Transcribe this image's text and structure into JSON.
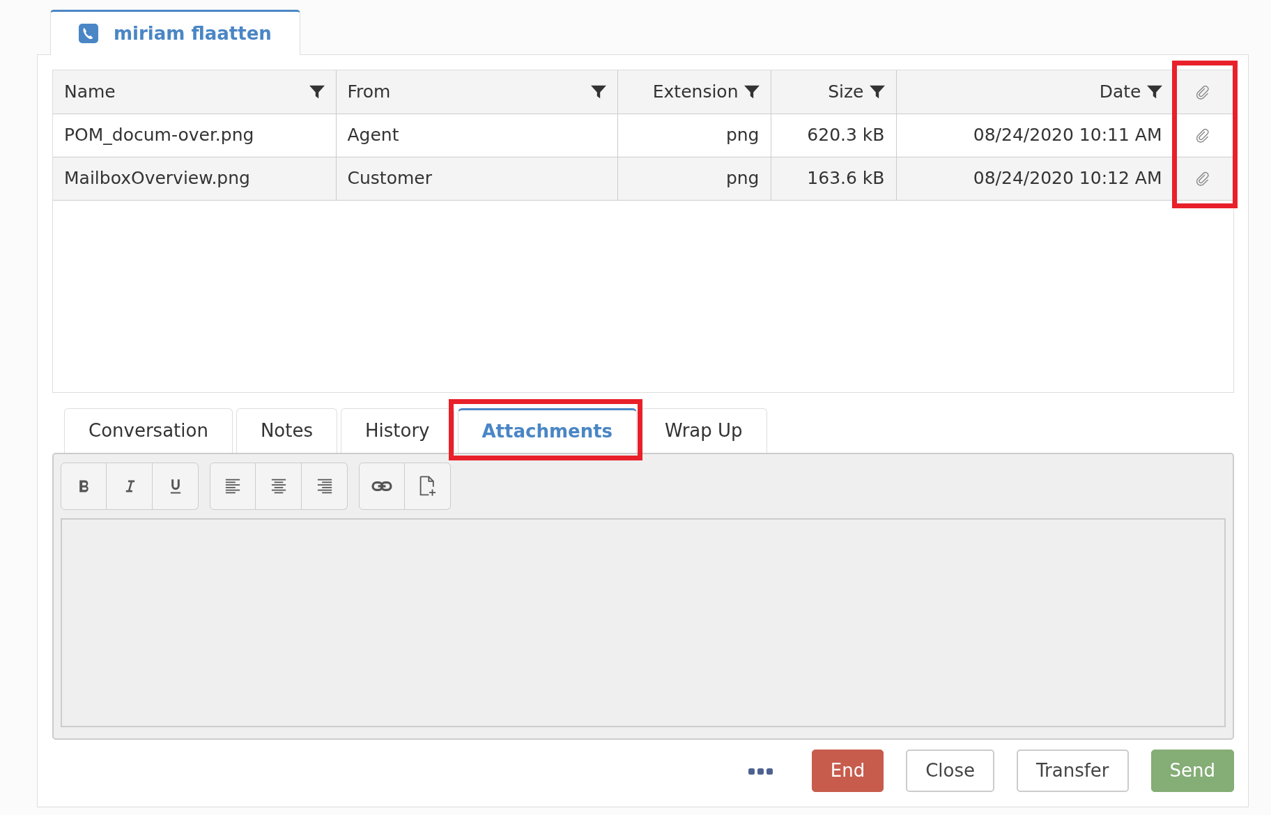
{
  "contact_tab": {
    "label": "miriam flaatten",
    "selected": true
  },
  "table": {
    "columns": [
      {
        "label": "Name",
        "kind": "text"
      },
      {
        "label": "From",
        "kind": "text"
      },
      {
        "label": "Extension",
        "kind": "number"
      },
      {
        "label": "Size",
        "kind": "number"
      },
      {
        "label": "Date",
        "kind": "number"
      }
    ],
    "attachment_column_highlighted": true,
    "rows": [
      {
        "cells": [
          "POM_docum-over.png",
          "Agent",
          "png",
          "620.3 kB",
          "08/24/2020 10:11 AM"
        ]
      },
      {
        "cells": [
          "MailboxOverview.png",
          "Customer",
          "png",
          "163.6 kB",
          "08/24/2020 10:12 AM"
        ]
      }
    ]
  },
  "tabs": [
    {
      "label": "Conversation",
      "selected": false,
      "highlighted": false
    },
    {
      "label": "Notes",
      "selected": false,
      "highlighted": false
    },
    {
      "label": "History",
      "selected": false,
      "highlighted": false
    },
    {
      "label": "Attachments",
      "selected": true,
      "highlighted": true
    },
    {
      "label": "Wrap Up",
      "selected": false,
      "highlighted": false
    }
  ],
  "toolbar_groups": [
    [
      {
        "kind": "bold"
      },
      {
        "kind": "italic"
      },
      {
        "kind": "underline"
      }
    ],
    [
      {
        "kind": "alignleft"
      },
      {
        "kind": "aligncenter"
      },
      {
        "kind": "alignright"
      }
    ],
    [
      {
        "kind": "link"
      },
      {
        "kind": "newfile"
      }
    ]
  ],
  "buttons": [
    {
      "label": "End",
      "kind": "danger"
    },
    {
      "label": "Close",
      "kind": "outline"
    },
    {
      "label": "Transfer",
      "kind": "outline"
    },
    {
      "label": "Send",
      "kind": "success"
    }
  ]
}
